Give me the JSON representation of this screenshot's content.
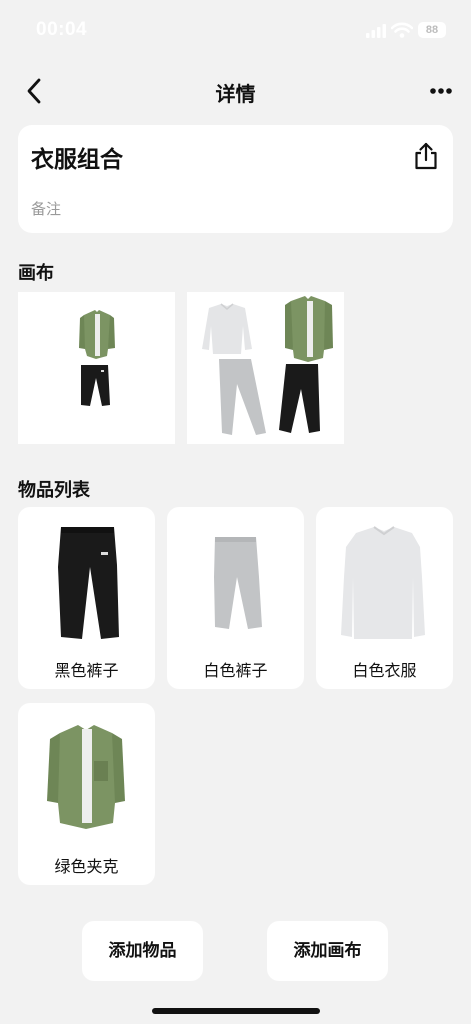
{
  "status_bar": {
    "time": "00:04",
    "battery": "88"
  },
  "nav": {
    "title": "详情"
  },
  "combo": {
    "title": "衣服组合",
    "note_placeholder": "备注"
  },
  "sections": {
    "canvas_title": "画布",
    "items_title": "物品列表"
  },
  "items": [
    {
      "label": "黑色裤子",
      "icon": "black-pants"
    },
    {
      "label": "白色裤子",
      "icon": "white-pants"
    },
    {
      "label": "白色衣服",
      "icon": "white-shirt"
    },
    {
      "label": "绿色夹克",
      "icon": "green-jacket"
    }
  ],
  "buttons": {
    "add_item": "添加物品",
    "add_canvas": "添加画布"
  },
  "colors": {
    "background": "#f2f2f2",
    "card": "#ffffff",
    "jacket_green": "#7c9463",
    "pants_black": "#1a1a1a",
    "pants_grey": "#c2c4c6"
  }
}
